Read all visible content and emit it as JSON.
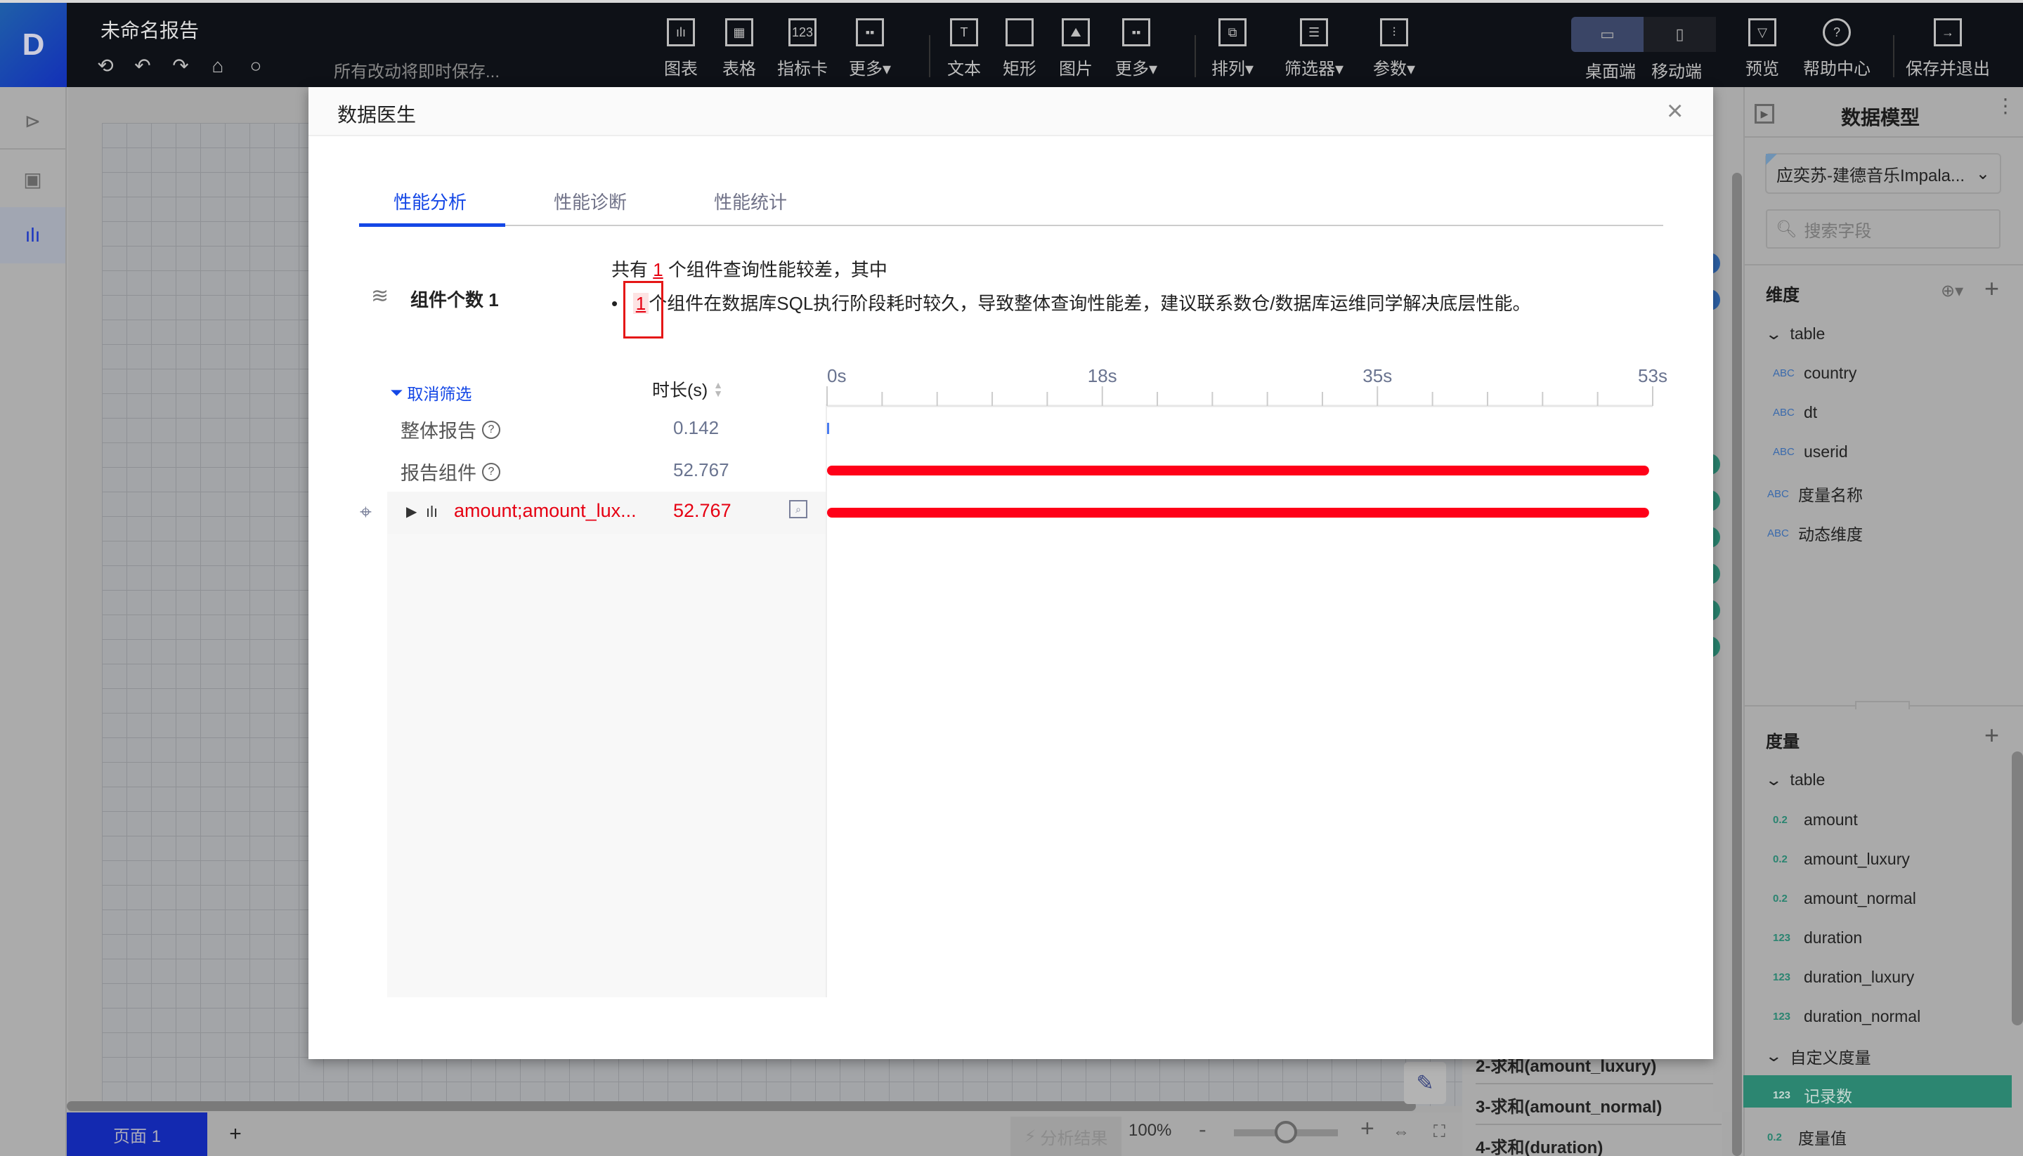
{
  "app": {
    "logo_glyph": "D",
    "report_title": "未命名报告",
    "save_status": "所有改动将即时保存...",
    "quick_tools": [
      {
        "icon": "replay-icon",
        "glyph": "⟲"
      },
      {
        "icon": "undo-icon",
        "glyph": "↶"
      },
      {
        "icon": "redo-icon",
        "glyph": "↷"
      },
      {
        "icon": "format-painter-icon",
        "glyph": "⌂"
      },
      {
        "icon": "refresh-icon",
        "glyph": "○"
      }
    ]
  },
  "toolbar": {
    "groups": [
      [
        {
          "label": "图表",
          "glyph": "📊",
          "icon": "chart-icon"
        },
        {
          "label": "表格",
          "glyph": "▦",
          "icon": "table-icon"
        },
        {
          "label": "指标卡",
          "glyph": "123",
          "icon": "kpi-card-icon"
        },
        {
          "label": "更多▾",
          "glyph": "▫",
          "icon": "more-grid-icon"
        }
      ],
      [
        {
          "label": "文本",
          "glyph": "T",
          "icon": "text-icon"
        },
        {
          "label": "矩形",
          "glyph": "□",
          "icon": "rectangle-icon"
        },
        {
          "label": "图片",
          "glyph": "⛰",
          "icon": "image-icon"
        },
        {
          "label": "更多▾",
          "glyph": "▫",
          "icon": "more-grid-icon"
        }
      ],
      [
        {
          "label": "排列▾",
          "glyph": "⧉",
          "icon": "arrange-icon"
        },
        {
          "label": "筛选器▾",
          "glyph": "☰",
          "icon": "filter-list-icon"
        },
        {
          "label": "参数▾",
          "glyph": "⫶",
          "icon": "parameter-icon"
        }
      ]
    ],
    "device": {
      "desktop": "桌面端",
      "mobile": "移动端",
      "active": "desktop"
    },
    "right_actions": [
      {
        "label": "预览",
        "glyph": "▭",
        "icon": "preview-icon"
      },
      {
        "label": "帮助中心",
        "glyph": "?",
        "icon": "help-icon"
      },
      {
        "label": "保存并退出",
        "glyph": "→",
        "icon": "save-exit-icon"
      }
    ]
  },
  "rail": {
    "items": [
      {
        "icon": "panel-expand-icon",
        "glyph": "▸",
        "active": false
      },
      {
        "icon": "component-icon",
        "glyph": "▣",
        "active": false
      },
      {
        "icon": "bar-chart-icon",
        "glyph": "📊",
        "active": true
      }
    ]
  },
  "bottom": {
    "page_tab": "页面 1",
    "add_page": "+",
    "analysis_result": "分析结果",
    "zoom_level": "100%",
    "zoom_minus": "-",
    "zoom_plus": "+",
    "zoom_fraction": 0.5
  },
  "measure_peek": [
    "2-求和(amount_luxury)",
    "3-求和(amount_normal)",
    "4-求和(duration)"
  ],
  "right_panel": {
    "title": "数据模型",
    "dataset": "应奕苏-建德音乐Impala...",
    "search_placeholder": "搜索字段",
    "dimensions": {
      "title": "维度",
      "group": "table",
      "fields": [
        {
          "type": "ABC",
          "name": "country"
        },
        {
          "type": "ABC",
          "name": "dt"
        },
        {
          "type": "ABC",
          "name": "userid"
        }
      ],
      "extra_fields": [
        {
          "type": "ABC",
          "name": "度量名称"
        },
        {
          "type": "ABC",
          "name": "动态维度"
        }
      ]
    },
    "measures": {
      "title": "度量",
      "group": "table",
      "fields": [
        {
          "type": "0.2",
          "name": "amount"
        },
        {
          "type": "0.2",
          "name": "amount_luxury"
        },
        {
          "type": "0.2",
          "name": "amount_normal"
        },
        {
          "type": "123",
          "name": "duration"
        },
        {
          "type": "123",
          "name": "duration_luxury"
        },
        {
          "type": "123",
          "name": "duration_normal"
        }
      ],
      "custom_group": "自定义度量",
      "custom_fields": [
        {
          "type": "123",
          "name": "记录数",
          "selected": true
        }
      ],
      "extra_fields": [
        {
          "type": "0.2",
          "name": "度量值"
        }
      ]
    }
  },
  "modal": {
    "title": "数据医生",
    "close": "×",
    "tabs": [
      {
        "label": "性能分析",
        "active": true
      },
      {
        "label": "性能诊断",
        "active": false
      },
      {
        "label": "性能统计",
        "active": false
      }
    ],
    "component_count_label": "组件个数 1",
    "summary": {
      "line1_pre": "共有 ",
      "line1_count": "1",
      "line1_post": " 个组件查询性能较差，其中",
      "bullet": "•",
      "line2_count": "1",
      "line2_text": "个组件在数据库SQL执行阶段耗时较久，导致整体查询性能差，建议联系数仓/数据库运维同学解决底层性能。"
    },
    "table": {
      "clear_filter": "取消筛选",
      "duration_header": "时长(s)",
      "rows": [
        {
          "label": "整体报告",
          "value": "0.142",
          "help": "?"
        },
        {
          "label": "报告组件",
          "value": "52.767",
          "help": "?"
        }
      ],
      "component": {
        "name": "amount;amount_lux...",
        "value": "52.767"
      }
    },
    "colors": {
      "accent": "#1447e6",
      "danger": "#e60012",
      "bar_small": "#4a7cf0",
      "bar_red": "#ff0018"
    }
  },
  "chart_data": {
    "type": "bar",
    "orientation": "horizontal-timeline",
    "title": "",
    "xlabel": "",
    "ylabel": "",
    "xlim": [
      0,
      53
    ],
    "x_ticks": [
      "0s",
      "18s",
      "35s",
      "53s"
    ],
    "x_tick_values": [
      0,
      17.67,
      35.33,
      53
    ],
    "minor_ticks_per_major": 5,
    "categories": [
      "整体报告",
      "报告组件",
      "amount;amount_lux..."
    ],
    "series": [
      {
        "name": "时长(s)",
        "values": [
          0.142,
          52.767,
          52.767
        ],
        "colors": [
          "#4a7cf0",
          "#ff0018",
          "#ff0018"
        ]
      }
    ],
    "grid": false,
    "legend": "none"
  }
}
